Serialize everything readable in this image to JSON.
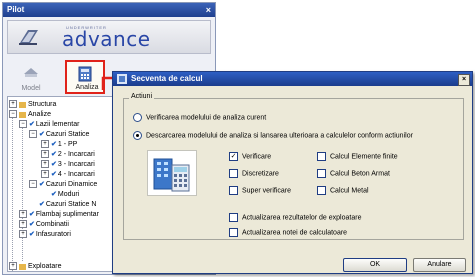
{
  "pilot": {
    "title": "Pilot",
    "close": "×",
    "brand_small": "UNDERWRITER",
    "brand": "advance",
    "tabs": [
      {
        "label": "Model",
        "icon": "model-icon"
      },
      {
        "label": "Analiza",
        "icon": "analiza-icon"
      }
    ]
  },
  "tree": [
    {
      "label": "Structura",
      "expander": "+",
      "check": "",
      "icon": "folder-icon"
    },
    {
      "label": "Analize",
      "expander": "−",
      "check": "",
      "icon": "folder-icon"
    },
    {
      "label": "Lazii lementar",
      "expander": "−",
      "check": "✔",
      "icon": ""
    },
    {
      "label": "Cazuri Statice",
      "expander": "−",
      "check": "✔",
      "icon": ""
    },
    {
      "label": "1 - PP",
      "expander": "+",
      "check": "✔",
      "icon": ""
    },
    {
      "label": "2 - Incarcari",
      "expander": "+",
      "check": "✔",
      "icon": ""
    },
    {
      "label": "3 - Incarcari",
      "expander": "+",
      "check": "✔",
      "icon": ""
    },
    {
      "label": "4 - Incarcari",
      "expander": "+",
      "check": "✔",
      "icon": ""
    },
    {
      "label": "Cazuri Dinamice",
      "expander": "−",
      "check": "✔",
      "icon": ""
    },
    {
      "label": "Moduri",
      "expander": "",
      "check": "✔",
      "icon": ""
    },
    {
      "label": "Cazuri Statice N",
      "expander": "",
      "check": "✔",
      "icon": ""
    },
    {
      "label": "Flambaj suplimentar",
      "expander": "+",
      "check": "✔",
      "icon": ""
    },
    {
      "label": "Combinatii",
      "expander": "+",
      "check": "✔",
      "icon": ""
    },
    {
      "label": "Infasuratori",
      "expander": "+",
      "check": "✔",
      "icon": ""
    },
    {
      "label": "Exploatare",
      "expander": "+",
      "check": "",
      "icon": "folder-icon"
    }
  ],
  "dialog": {
    "title": "Secventa de calcul",
    "close": "×",
    "group_label": "Actiuni",
    "radio1": "Verificarea modelului de analiza curent",
    "radio2": "Descarcarea modelului de analiza si lansarea ulterioara a calculelor conform actiunilor",
    "checks": {
      "verificare": {
        "label": "Verificare",
        "checked": true
      },
      "calcul_elemente_finite": {
        "label": "Calcul Elemente finite",
        "checked": false
      },
      "discretizare": {
        "label": "Discretizare",
        "checked": false
      },
      "calcul_beton_armat": {
        "label": "Calcul Beton Armat",
        "checked": false
      },
      "super_verificare": {
        "label": "Super verificare",
        "checked": false
      },
      "calcul_metal": {
        "label": "Calcul Metal",
        "checked": false
      },
      "actualizare_exploatare": {
        "label": "Actualizarea rezultatelor de exploatare",
        "checked": false
      },
      "actualizare_calculatoare": {
        "label": "Actualizarea notei de calculatoare",
        "checked": false
      }
    },
    "ok": "OK",
    "cancel": "Anulare"
  },
  "colors": {
    "title_bar": "#1e3f8e",
    "highlight": "#e0231a",
    "dialog_bg": "#ece9d8"
  }
}
